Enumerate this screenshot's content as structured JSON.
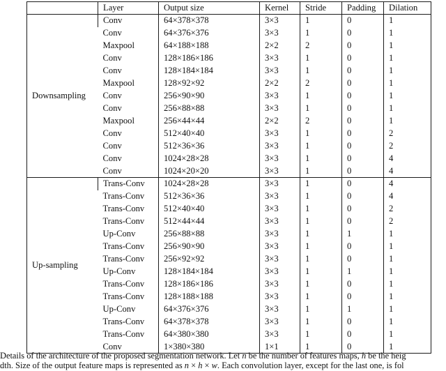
{
  "table": {
    "headers": [
      "",
      "Layer",
      "Output size",
      "Kernel",
      "Stride",
      "Padding",
      "Dilation"
    ],
    "sections": [
      {
        "label": "Downsampling",
        "rows": [
          {
            "layer": "Conv",
            "output": "64×378×378",
            "kernel": "3×3",
            "stride": "1",
            "padding": "0",
            "dilation": "1"
          },
          {
            "layer": "Conv",
            "output": "64×376×376",
            "kernel": "3×3",
            "stride": "1",
            "padding": "0",
            "dilation": "1"
          },
          {
            "layer": "Maxpool",
            "output": "64×188×188",
            "kernel": "2×2",
            "stride": "2",
            "padding": "0",
            "dilation": "1"
          },
          {
            "layer": "Conv",
            "output": "128×186×186",
            "kernel": "3×3",
            "stride": "1",
            "padding": "0",
            "dilation": "1"
          },
          {
            "layer": "Conv",
            "output": "128×184×184",
            "kernel": "3×3",
            "stride": "1",
            "padding": "0",
            "dilation": "1"
          },
          {
            "layer": "Maxpool",
            "output": "128×92×92",
            "kernel": "2×2",
            "stride": "2",
            "padding": "0",
            "dilation": "1"
          },
          {
            "layer": "Conv",
            "output": "256×90×90",
            "kernel": "3×3",
            "stride": "1",
            "padding": "0",
            "dilation": "1"
          },
          {
            "layer": "Conv",
            "output": "256×88×88",
            "kernel": "3×3",
            "stride": "1",
            "padding": "0",
            "dilation": "1"
          },
          {
            "layer": "Maxpool",
            "output": "256×44×44",
            "kernel": "2×2",
            "stride": "2",
            "padding": "0",
            "dilation": "1"
          },
          {
            "layer": "Conv",
            "output": "512×40×40",
            "kernel": "3×3",
            "stride": "1",
            "padding": "0",
            "dilation": "2"
          },
          {
            "layer": "Conv",
            "output": "512×36×36",
            "kernel": "3×3",
            "stride": "1",
            "padding": "0",
            "dilation": "2"
          },
          {
            "layer": "Conv",
            "output": "1024×28×28",
            "kernel": "3×3",
            "stride": "1",
            "padding": "0",
            "dilation": "4"
          },
          {
            "layer": "Conv",
            "output": "1024×20×20",
            "kernel": "3×3",
            "stride": "1",
            "padding": "0",
            "dilation": "4"
          }
        ]
      },
      {
        "label": "Up-sampling",
        "rows": [
          {
            "layer": "Trans-Conv",
            "output": "1024×28×28",
            "kernel": "3×3",
            "stride": "1",
            "padding": "0",
            "dilation": "4"
          },
          {
            "layer": "Trans-Conv",
            "output": "512×36×36",
            "kernel": "3×3",
            "stride": "1",
            "padding": "0",
            "dilation": "4"
          },
          {
            "layer": "Trans-Conv",
            "output": "512×40×40",
            "kernel": "3×3",
            "stride": "1",
            "padding": "0",
            "dilation": "2"
          },
          {
            "layer": "Trans-Conv",
            "output": "512×44×44",
            "kernel": "3×3",
            "stride": "1",
            "padding": "0",
            "dilation": "2"
          },
          {
            "layer": "Up-Conv",
            "output": "256×88×88",
            "kernel": "3×3",
            "stride": "1",
            "padding": "1",
            "dilation": "1"
          },
          {
            "layer": "Trans-Conv",
            "output": "256×90×90",
            "kernel": "3×3",
            "stride": "1",
            "padding": "0",
            "dilation": "1"
          },
          {
            "layer": "Trans-Conv",
            "output": "256×92×92",
            "kernel": "3×3",
            "stride": "1",
            "padding": "0",
            "dilation": "1"
          },
          {
            "layer": "Up-Conv",
            "output": "128×184×184",
            "kernel": "3×3",
            "stride": "1",
            "padding": "1",
            "dilation": "1"
          },
          {
            "layer": "Trans-Conv",
            "output": "128×186×186",
            "kernel": "3×3",
            "stride": "1",
            "padding": "0",
            "dilation": "1"
          },
          {
            "layer": "Trans-Conv",
            "output": "128×188×188",
            "kernel": "3×3",
            "stride": "1",
            "padding": "0",
            "dilation": "1"
          },
          {
            "layer": "Up-Conv",
            "output": "64×376×376",
            "kernel": "3×3",
            "stride": "1",
            "padding": "1",
            "dilation": "1"
          },
          {
            "layer": "Trans-Conv",
            "output": "64×378×378",
            "kernel": "3×3",
            "stride": "1",
            "padding": "0",
            "dilation": "1"
          },
          {
            "layer": "Trans-Conv",
            "output": "64×380×380",
            "kernel": "3×3",
            "stride": "1",
            "padding": "0",
            "dilation": "1"
          },
          {
            "layer": "Conv",
            "output": "1×380×380",
            "kernel": "1×1",
            "stride": "1",
            "padding": "0",
            "dilation": "1"
          }
        ]
      }
    ]
  },
  "caption": {
    "line1": "Details of the architecture of the proposed segmentation network.  Let n be the number of features maps, h be the heig",
    "line2": "dth. Size of the output feature maps is represented as n × h × w. Each convolution layer, except for the last one, is fol"
  }
}
